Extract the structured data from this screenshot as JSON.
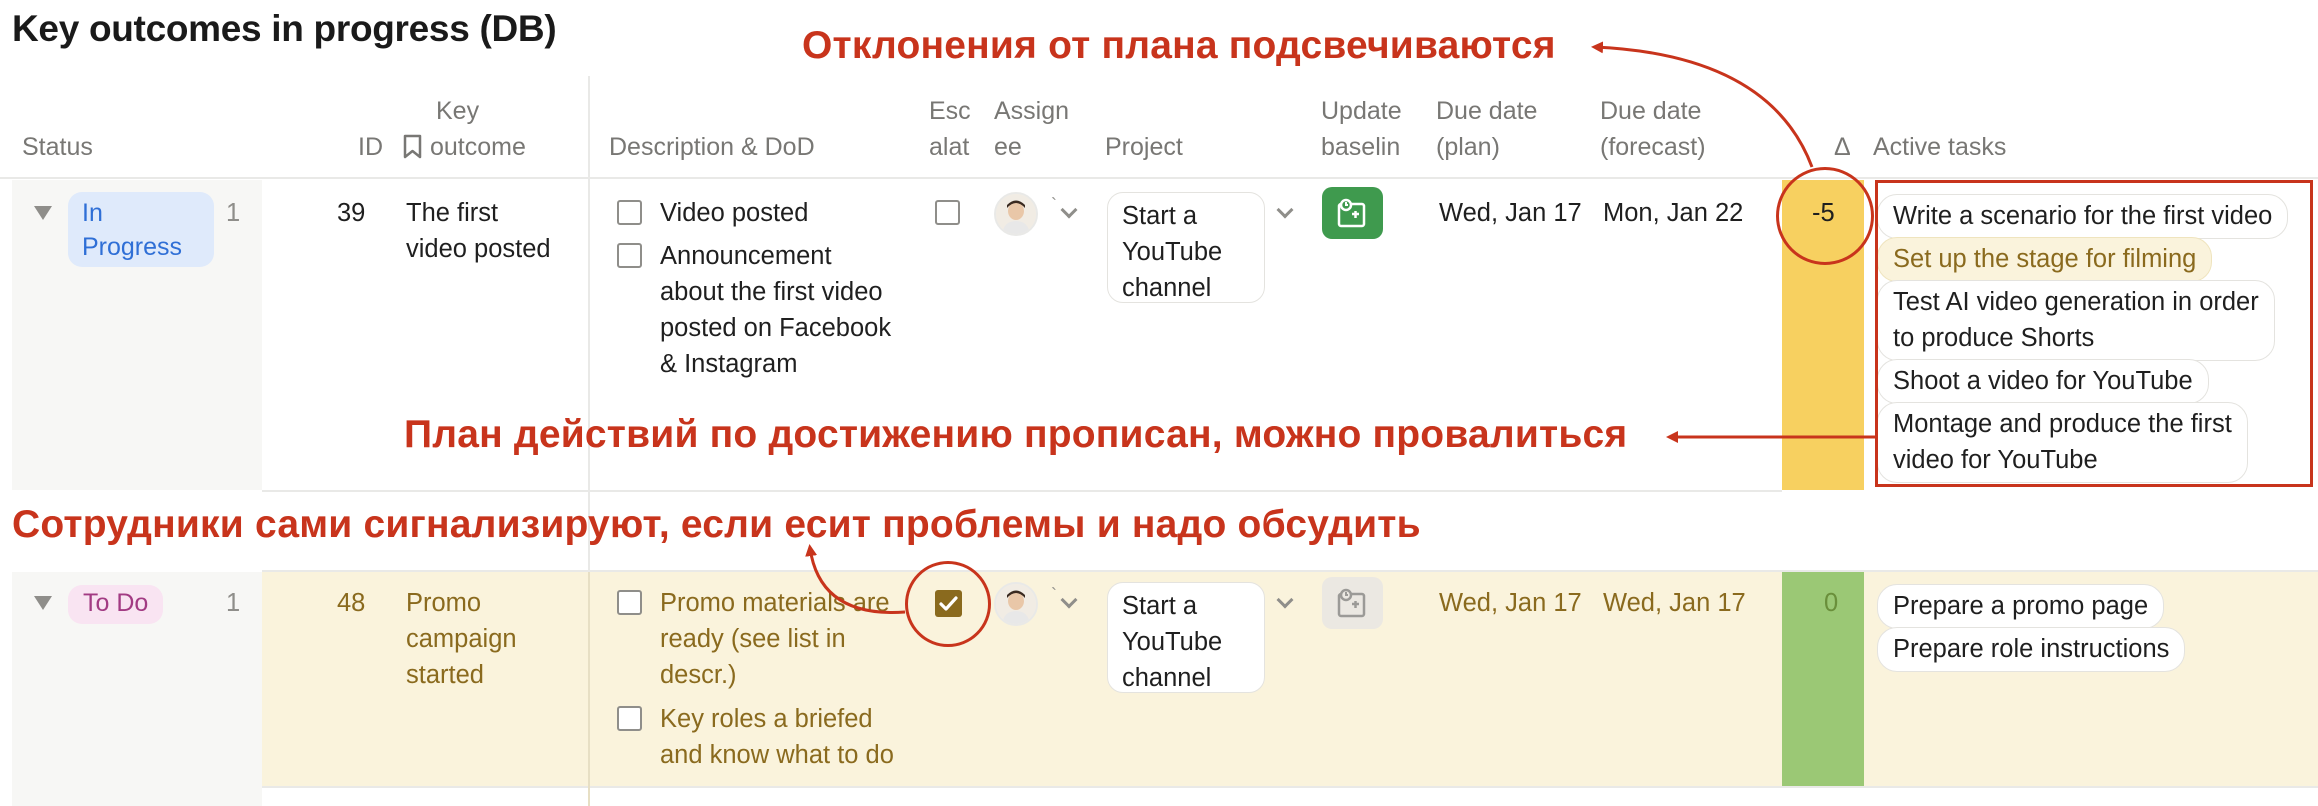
{
  "title": "Key outcomes in progress (DB)",
  "columns": {
    "status": "Status",
    "id": "ID",
    "key_outcome_line1": "Key",
    "key_outcome_line2": "outcome",
    "description": "Description & DoD",
    "escalate_line1": "Esc",
    "escalate_line2": "alat",
    "assignee_line1": "Assign",
    "assignee_line2": "ee",
    "project": "Project",
    "update_line1": "Update",
    "update_line2": "baselin",
    "due_plan_line1": "Due date",
    "due_plan_line2": "(plan)",
    "due_forecast_line1": "Due date",
    "due_forecast_line2": "(forecast)",
    "delta": "Δ",
    "active_tasks": "Active tasks"
  },
  "rows": [
    {
      "status": "In Progress",
      "status_line1": "In",
      "status_line2": "Progress",
      "count": "1",
      "id": "39",
      "key_outcome_line1": "The first",
      "key_outcome_line2": "video posted",
      "description": [
        {
          "lines": [
            "Video posted"
          ],
          "checked": false
        },
        {
          "lines": [
            "Announcement",
            "about the first video",
            "posted on Facebook",
            "& Instagram"
          ],
          "checked": false
        }
      ],
      "escalated": false,
      "project_lines": [
        "Start a",
        "YouTube",
        "channel"
      ],
      "update_icon": "baseline-update-icon",
      "due_plan": "Wed, Jan 17",
      "due_forecast": "Mon, Jan 22",
      "delta": "-5",
      "delta_color": "#f7d060",
      "active_tasks": [
        {
          "lines": [
            "Write a scenario for the first video"
          ],
          "highlight": false
        },
        {
          "lines": [
            "Set up the stage for filming"
          ],
          "highlight": true
        },
        {
          "lines": [
            "Test AI video generation in order",
            "to produce Shorts"
          ],
          "highlight": false
        },
        {
          "lines": [
            "Shoot a video for YouTube"
          ],
          "highlight": false
        },
        {
          "lines": [
            "Montage and produce the first",
            "video for YouTube"
          ],
          "highlight": false
        }
      ]
    },
    {
      "status": "To Do",
      "count": "1",
      "id": "48",
      "key_outcome_lines": [
        "Promo",
        "campaign",
        "started"
      ],
      "description": [
        {
          "lines": [
            "Promo materials are",
            "ready (see list in",
            "descr.)"
          ],
          "checked": false
        },
        {
          "lines": [
            "Key roles a briefed",
            "and know what to do"
          ],
          "checked": false
        }
      ],
      "escalated": true,
      "project_lines": [
        "Start a",
        "YouTube",
        "channel"
      ],
      "update_icon": "baseline-update-icon",
      "due_plan": "Wed, Jan 17",
      "due_forecast": "Wed, Jan 17",
      "delta": "0",
      "delta_color": "#9bc875",
      "row_color": "#faf3dc",
      "active_tasks": [
        {
          "lines": [
            "Prepare a promo page"
          ],
          "highlight": false
        },
        {
          "lines": [
            "Prepare role instructions"
          ],
          "highlight": false
        }
      ]
    }
  ],
  "annotations": {
    "deviations": "Отклонения от плана подсвечиваются",
    "action_plan": "План действий по достижению прописан, можно провалиться",
    "escalation": "Сотрудники сами сигнализируют, если есит проблемы и надо обсудить"
  },
  "colors": {
    "annotation_red": "#c8341c",
    "update_button_green": "#3f9a4e",
    "in_progress_pill": "#dfeafb",
    "todo_pill": "#f9e4f2"
  }
}
